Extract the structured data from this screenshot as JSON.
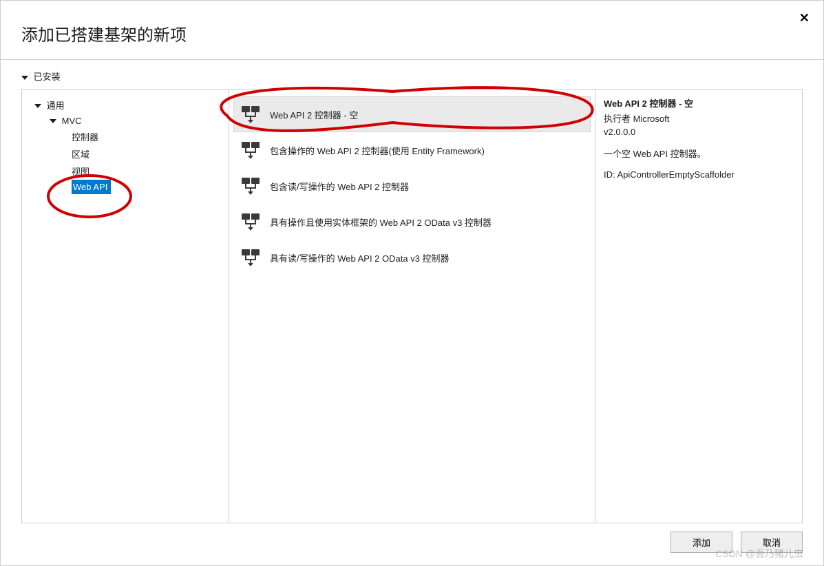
{
  "dialog": {
    "title": "添加已搭建基架的新项",
    "close": "✕"
  },
  "tree": {
    "installed": "已安装",
    "general": "通用",
    "mvc": "MVC",
    "controller": "控制器",
    "area": "区域",
    "view": "视图",
    "webapi": "Web API"
  },
  "items": [
    {
      "label": "Web API 2 控制器 - 空",
      "selected": true
    },
    {
      "label": "包含操作的 Web API 2 控制器(使用 Entity Framework)",
      "selected": false
    },
    {
      "label": "包含读/写操作的 Web API 2 控制器",
      "selected": false
    },
    {
      "label": "具有操作且使用实体框架的 Web API 2 OData v3 控制器",
      "selected": false
    },
    {
      "label": "具有读/写操作的 Web API 2 OData v3 控制器",
      "selected": false
    }
  ],
  "details": {
    "title": "Web API 2 控制器 - 空",
    "author": "执行者 Microsoft",
    "version": "v2.0.0.0",
    "description": "一个空 Web API 控制器。",
    "id": "ID: ApiControllerEmptyScaffolder"
  },
  "buttons": {
    "add": "添加",
    "cancel": "取消"
  },
  "watermark": "CSDN @吾乃猪儿虫"
}
